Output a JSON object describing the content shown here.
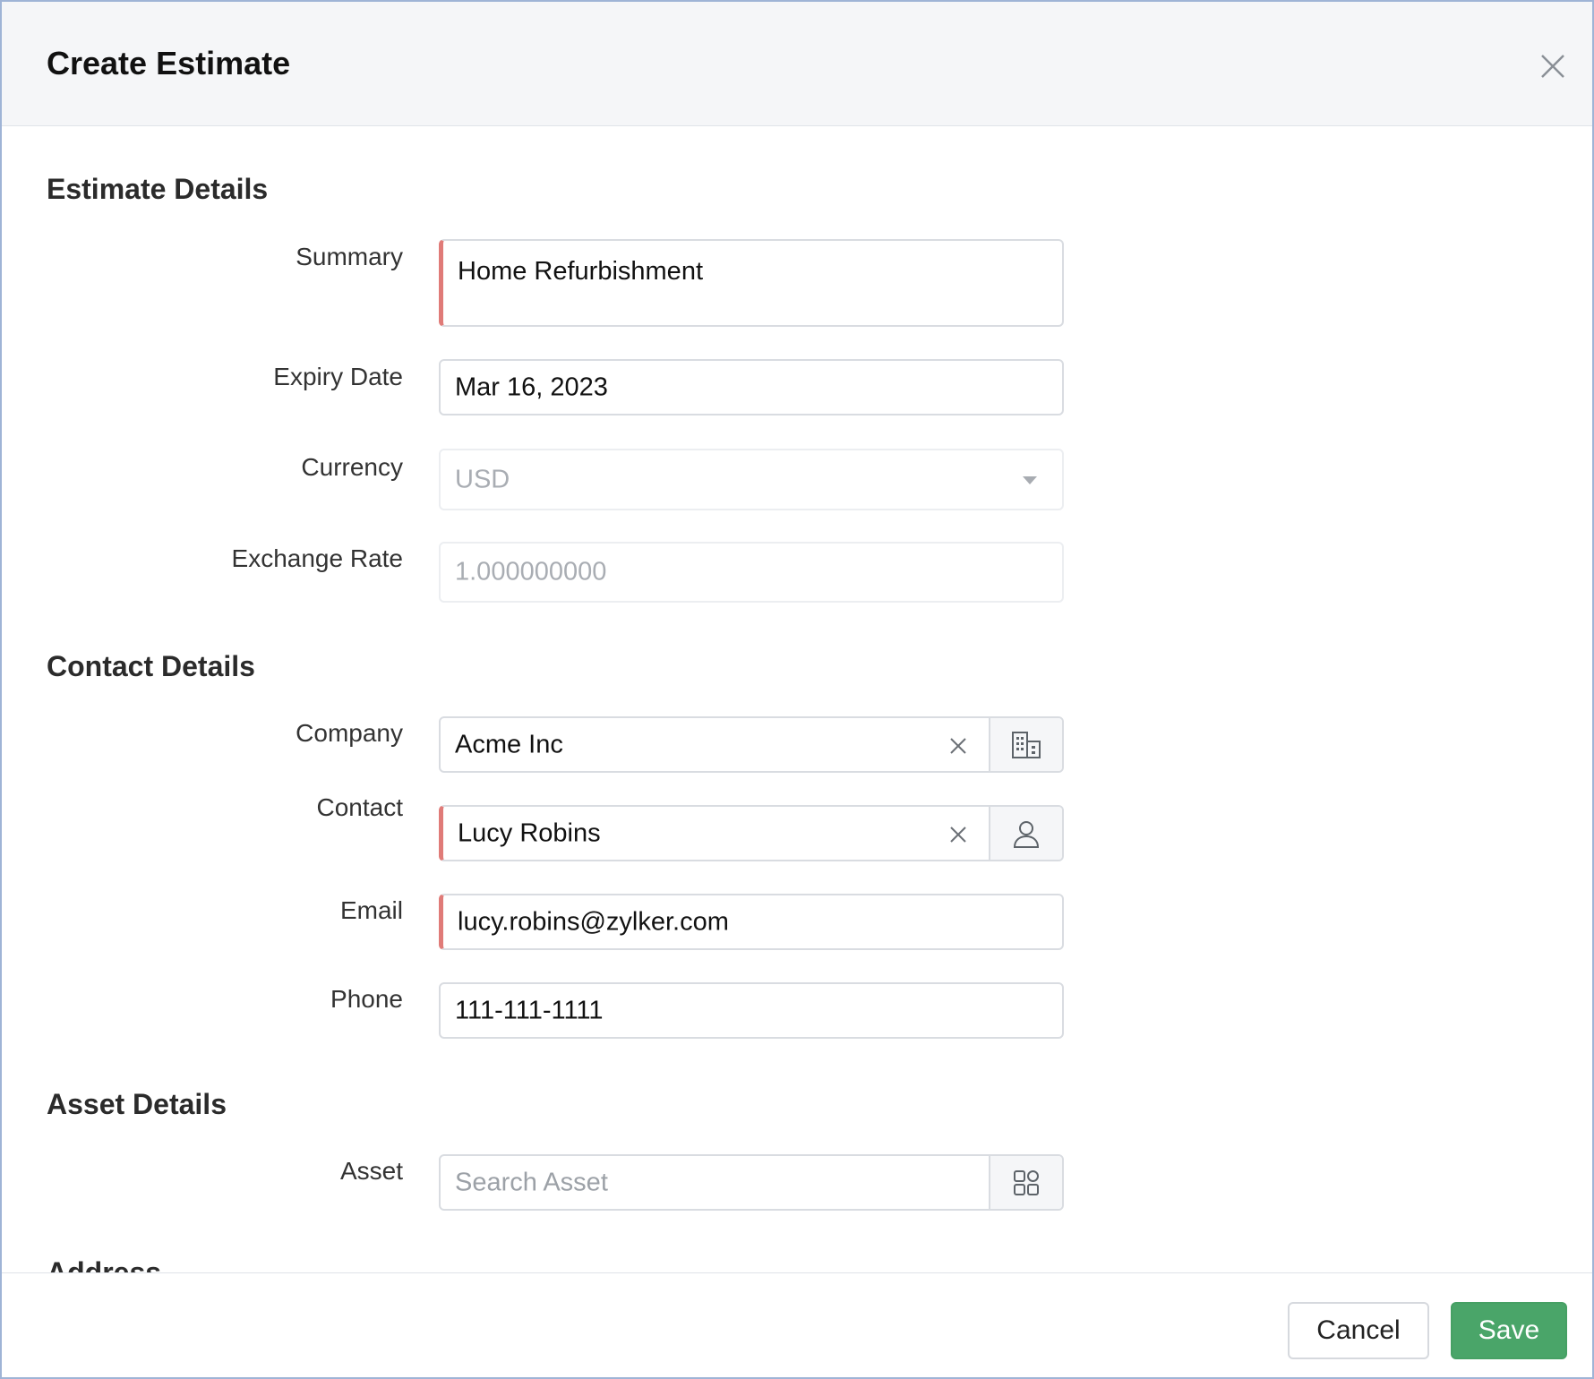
{
  "dialog": {
    "title": "Create Estimate",
    "close_icon": "close-icon"
  },
  "sections": {
    "estimate_details": "Estimate Details",
    "contact_details": "Contact Details",
    "asset_details": "Asset Details",
    "address": "Address"
  },
  "fields": {
    "summary": {
      "label": "Summary",
      "value": "Home Refurbishment",
      "required": true
    },
    "expiry_date": {
      "label": "Expiry Date",
      "value": "Mar 16, 2023"
    },
    "currency": {
      "label": "Currency",
      "value": "USD",
      "disabled": true,
      "icon": "chevron-down-icon"
    },
    "exchange_rate": {
      "label": "Exchange Rate",
      "value": "1.000000000",
      "disabled": true
    },
    "company": {
      "label": "Company",
      "value": "Acme Inc",
      "clear_icon": "clear-icon",
      "addon_icon": "building-icon"
    },
    "contact": {
      "label": "Contact",
      "value": "Lucy Robins",
      "required": true,
      "clear_icon": "clear-icon",
      "addon_icon": "user-icon"
    },
    "email": {
      "label": "Email",
      "value": "lucy.robins@zylker.com",
      "required": true
    },
    "phone": {
      "label": "Phone",
      "value": "111-111-1111"
    },
    "asset": {
      "label": "Asset",
      "placeholder": "Search Asset",
      "addon_icon": "asset-grid-icon"
    }
  },
  "footer": {
    "cancel_label": "Cancel",
    "save_label": "Save"
  },
  "colors": {
    "save_button": "#4aa569",
    "required_marker": "#e07b78",
    "header_bg": "#f5f6f8"
  }
}
